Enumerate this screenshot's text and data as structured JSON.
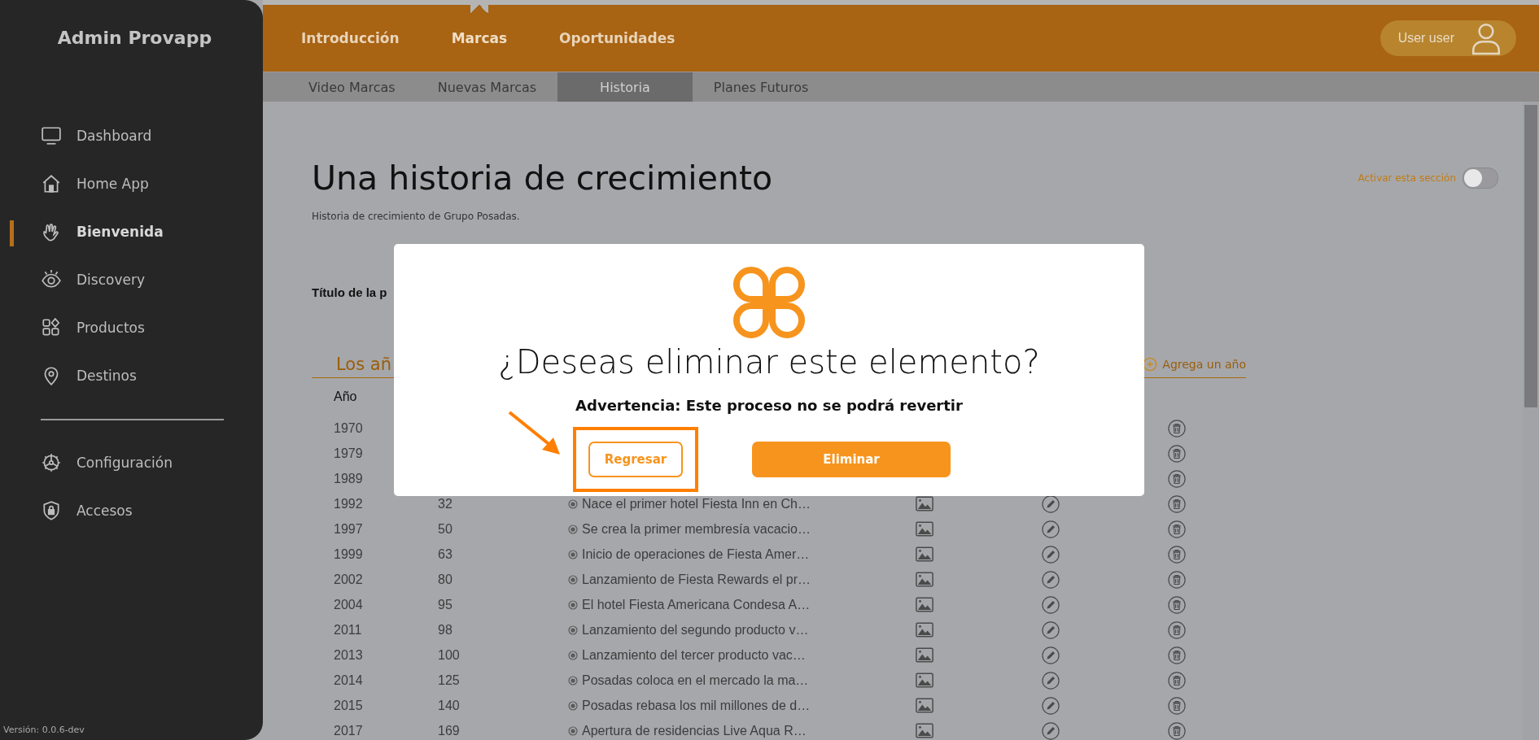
{
  "sidebar": {
    "title": "Admin Provapp",
    "items": [
      {
        "label": "Dashboard",
        "selected": false
      },
      {
        "label": "Home App",
        "selected": false
      },
      {
        "label": "Bienvenida",
        "selected": true
      },
      {
        "label": "Discovery",
        "selected": false
      },
      {
        "label": "Productos",
        "selected": false
      },
      {
        "label": "Destinos",
        "selected": false
      }
    ],
    "settings_items": [
      {
        "label": "Configuración",
        "selected": false
      },
      {
        "label": "Accesos",
        "selected": false
      }
    ],
    "version": "Versión: 0.0.6-dev"
  },
  "top_nav": {
    "tabs": [
      {
        "label": "Introducción",
        "selected": false
      },
      {
        "label": "Marcas",
        "selected": true
      },
      {
        "label": "Oportunidades",
        "selected": false
      }
    ],
    "user": "User user"
  },
  "sub_nav": {
    "tabs": [
      {
        "label": "Video Marcas",
        "selected": false
      },
      {
        "label": "Nuevas Marcas",
        "selected": false
      },
      {
        "label": "Historia",
        "selected": true
      },
      {
        "label": "Planes Futuros",
        "selected": false
      }
    ]
  },
  "page": {
    "title": "Una historia de crecimiento",
    "subtitle": "Historia de crecimiento de Grupo Posadas.",
    "toggle": {
      "label": "Activar esta sección",
      "on": false
    },
    "field_label": "Título de la p",
    "section_title": "Los añ",
    "add_link": "Agrega un año",
    "table": {
      "columns": [
        "Año"
      ],
      "rows": [
        {
          "year": "1970"
        },
        {
          "year": "1979"
        },
        {
          "year": "1989"
        },
        {
          "year": "1992",
          "number": "32",
          "text": "Nace el primer hotel Fiesta Inn en Ch…"
        },
        {
          "year": "1997",
          "number": "50",
          "text": "Se crea la primer membresía vacacio…"
        },
        {
          "year": "1999",
          "number": "63",
          "text": "Inicio de operaciones de Fiesta Amer…"
        },
        {
          "year": "2002",
          "number": "80",
          "text": "Lanzamiento de Fiesta Rewards el pr…"
        },
        {
          "year": "2004",
          "number": "95",
          "text": "El hotel Fiesta Americana Condesa A…"
        },
        {
          "year": "2011",
          "number": "98",
          "text": "Lanzamiento del segundo producto v…"
        },
        {
          "year": "2013",
          "number": "100",
          "text": "Lanzamiento del tercer producto vac…"
        },
        {
          "year": "2014",
          "number": "125",
          "text": "Posadas coloca en el mercado la ma…"
        },
        {
          "year": "2015",
          "number": "140",
          "text": "Posadas rebasa los mil millones de d…"
        },
        {
          "year": "2017",
          "number": "169",
          "text": "Apertura de residencias Live Aqua R…"
        }
      ]
    }
  },
  "dialog": {
    "title": "¿Deseas eliminar este elemento?",
    "warning": "Advertencia: Este proceso no se podrá revertir",
    "buttons": [
      {
        "label": "Regresar",
        "kind": "secondary",
        "highlighted": true
      },
      {
        "label": "Eliminar",
        "kind": "primary",
        "highlighted": false
      }
    ]
  }
}
